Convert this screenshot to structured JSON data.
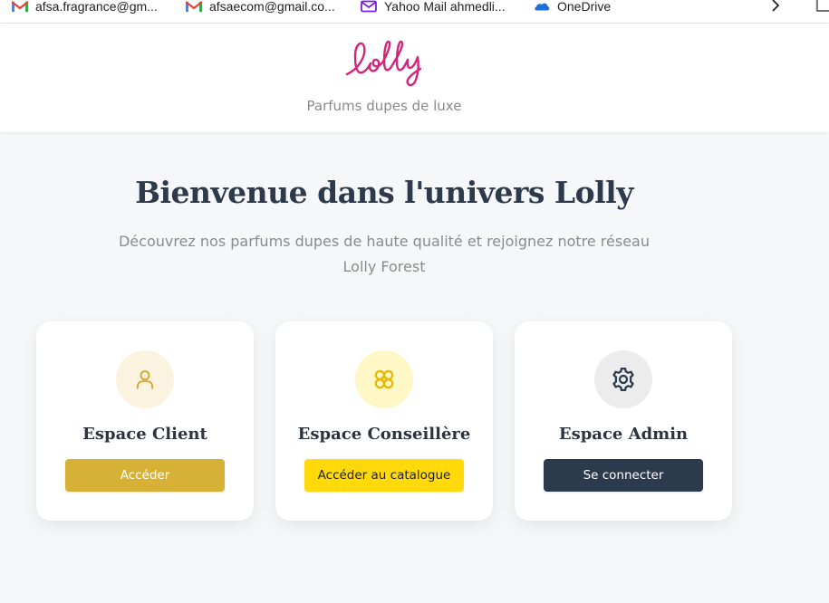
{
  "bookmarks_bar": {
    "items": [
      {
        "label": "afsa.fragrance@gm...",
        "icon": "gmail-icon"
      },
      {
        "label": "afsaecom@gmail.co...",
        "icon": "gmail-icon"
      },
      {
        "label": "Yahoo Mail ahmedli...",
        "icon": "yahoo-mail-icon"
      },
      {
        "label": "OneDrive",
        "icon": "onedrive-icon"
      }
    ]
  },
  "header": {
    "logo_text": "lolly",
    "tagline": "Parfums dupes de luxe"
  },
  "hero": {
    "title": "Bienvenue dans l'univers Lolly",
    "subtitle_line1": "Découvrez nos parfums dupes de haute qualité et rejoignez notre réseau",
    "subtitle_line2": "Lolly Forest"
  },
  "cards": [
    {
      "title": "Espace Client",
      "button": "Accéder",
      "icon": "user-icon"
    },
    {
      "title": "Espace Conseillère",
      "button": "Accéder au catalogue",
      "icon": "flower-icon"
    },
    {
      "title": "Espace Admin",
      "button": "Se connecter",
      "icon": "gear-icon"
    }
  ],
  "colors": {
    "brand_pink": "#d6237a",
    "client_gold": "#d6b136",
    "conseillere_yellow": "#ffd90a",
    "admin_navy": "#2c3a4d",
    "heading": "#2c3a4b",
    "background": "#f6f7f9"
  }
}
